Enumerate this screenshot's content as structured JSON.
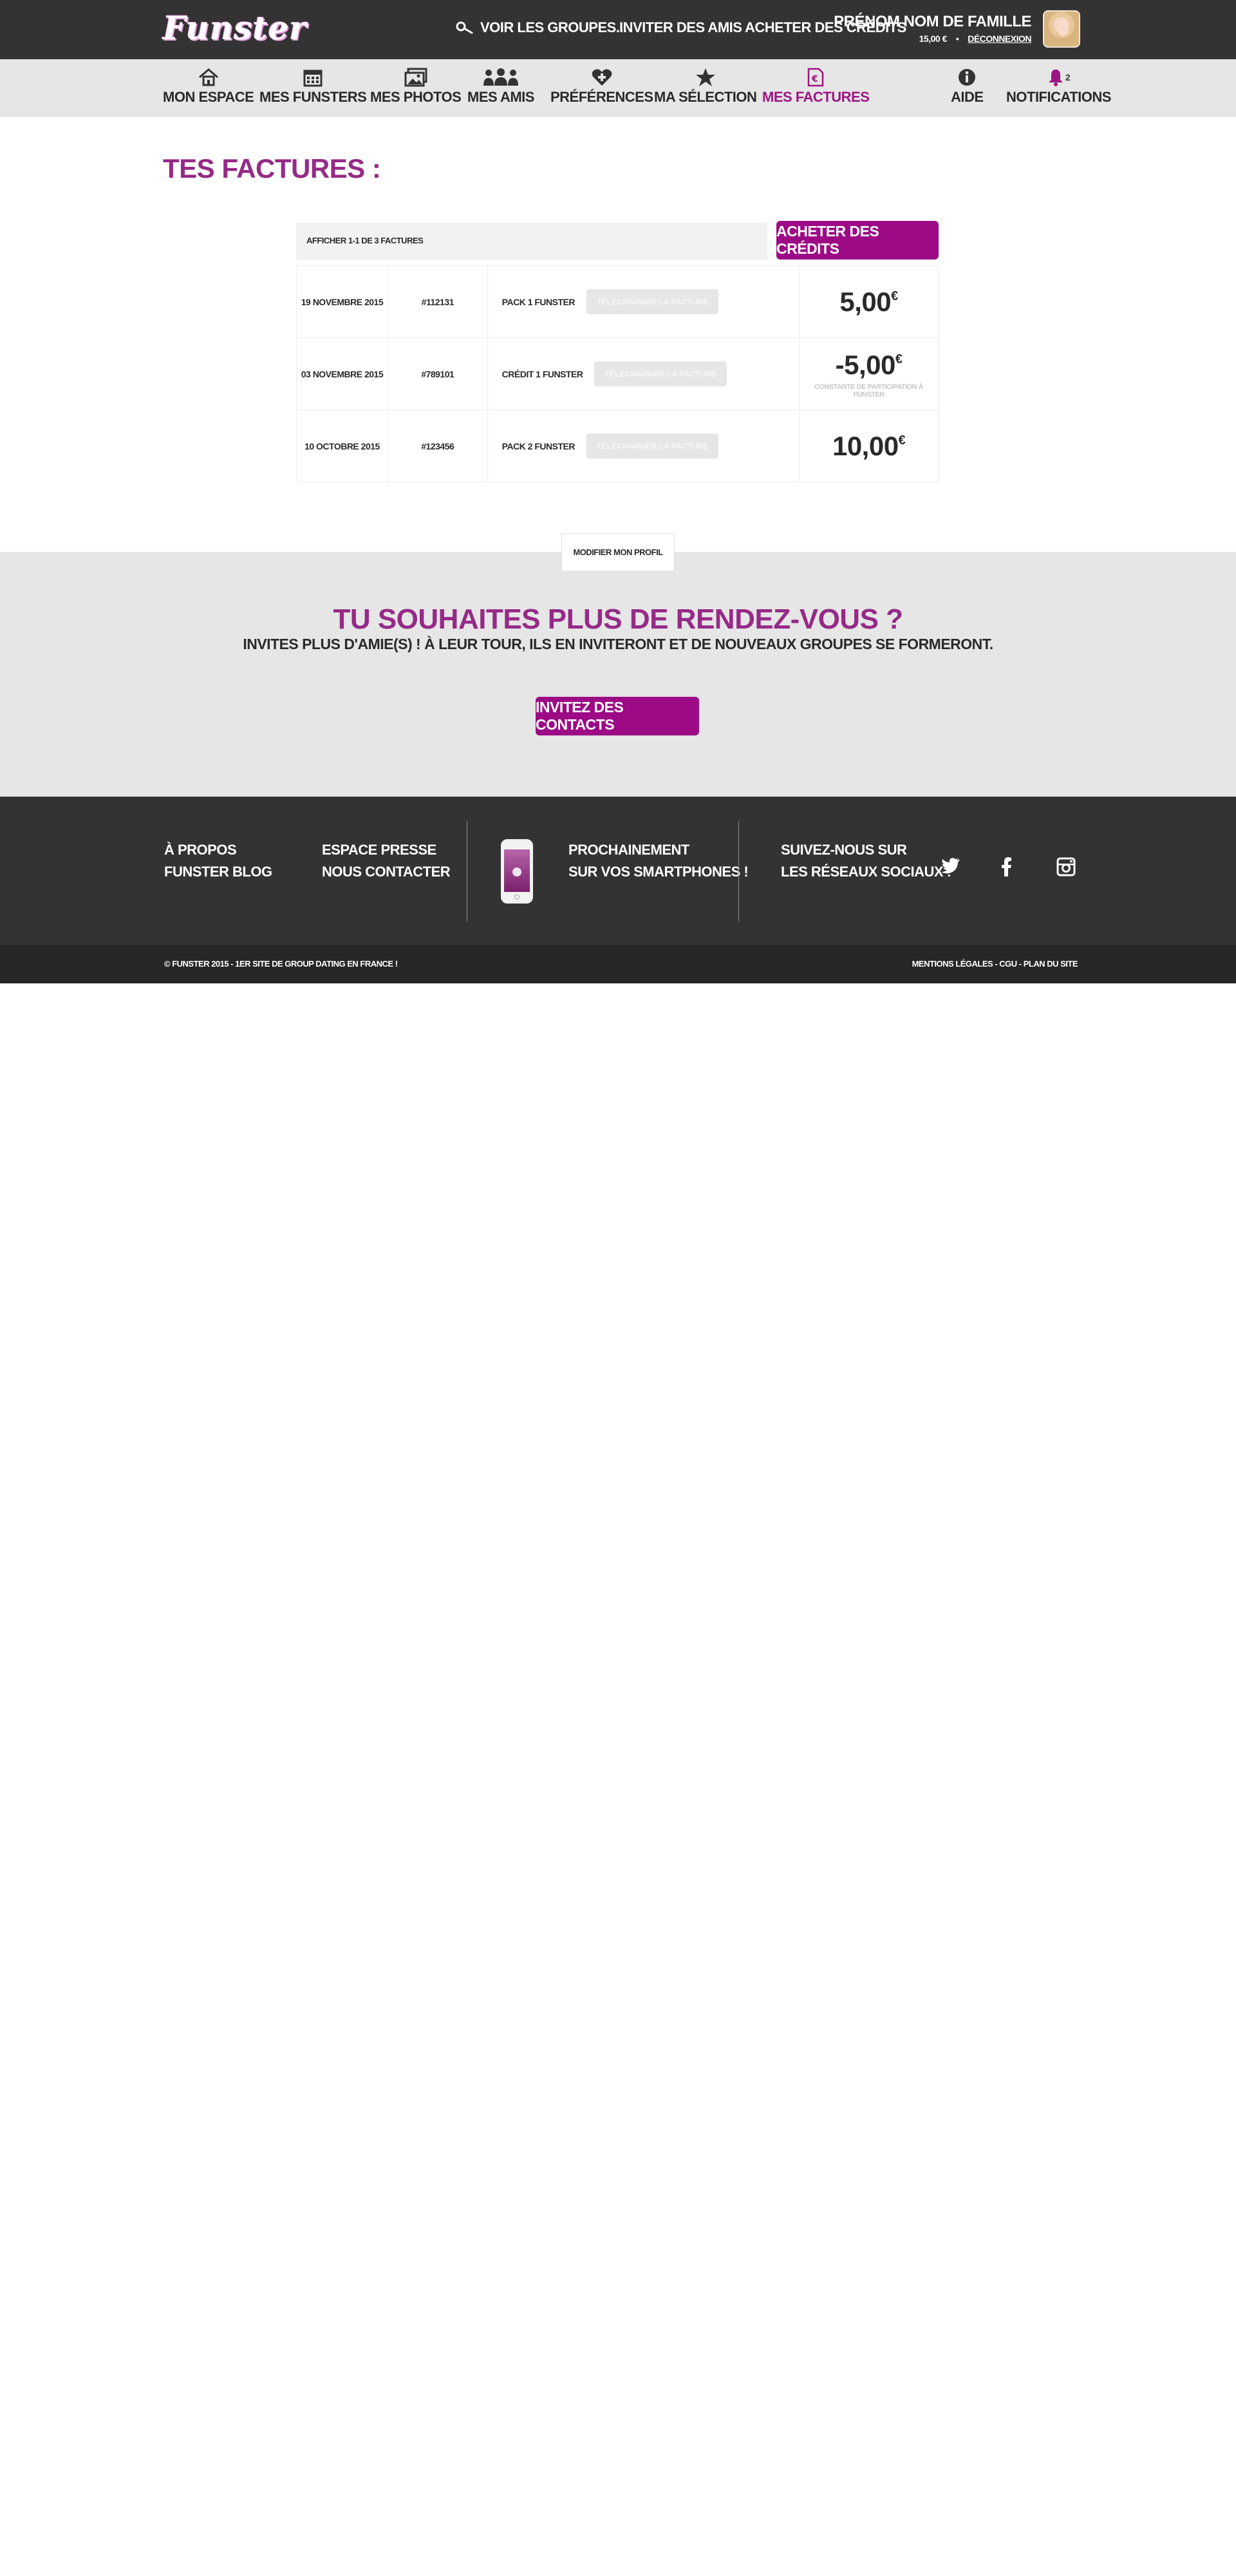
{
  "header": {
    "logo": "Funster",
    "nav": {
      "search": "Voir les groupes...",
      "invite": "Inviter des amis",
      "buy": "Acheter des crédits"
    },
    "user": {
      "name": "Prénom Nom de famille",
      "credits": "15,00 €",
      "separator": "•",
      "logout": "Déconnexion"
    }
  },
  "subnav": {
    "items": [
      {
        "label": "Mon espace",
        "icon": "home-icon"
      },
      {
        "label": "Mes funsters",
        "icon": "calendar-icon"
      },
      {
        "label": "Mes photos",
        "icon": "photos-icon"
      },
      {
        "label": "Mes amis",
        "icon": "friends-icon"
      },
      {
        "label": "Préférences",
        "icon": "heart-plus-icon"
      },
      {
        "label": "Ma sélection",
        "icon": "star-icon"
      },
      {
        "label": "Mes factures",
        "icon": "invoice-icon",
        "active": true
      }
    ],
    "right": [
      {
        "label": "Aide",
        "icon": "info-icon"
      },
      {
        "label": "Notifications",
        "icon": "bell-icon",
        "badge": "2"
      }
    ]
  },
  "main": {
    "title": "Tes factures :",
    "filter": "Afficher 1-1 de 3 factures",
    "buy_button": "Acheter des crédits",
    "invoices": [
      {
        "date": "19 novembre 2015",
        "number": "#112131",
        "description": "Pack 1 Funster",
        "download": "Télécharger la facture",
        "amount": "5,00",
        "currency": "€",
        "note": ""
      },
      {
        "date": "03 novembre 2015",
        "number": "#789101",
        "description": "Crédit 1 Funster",
        "download": "Télécharger la facture",
        "amount": "-5,00",
        "currency": "€",
        "note": "Constante de participation à FUNSTER"
      },
      {
        "date": "10 octobre 2015",
        "number": "#123456",
        "description": "Pack 2 Funster",
        "download": "Télécharger la facture",
        "amount": "10,00",
        "currency": "€",
        "note": ""
      }
    ]
  },
  "profile_tab": "Modifier mon profil",
  "invite": {
    "title": "Tu souhaites plus de rendez-vous ?",
    "subtitle": "Invites plus d'amie(s) ! à leur tour, ils en inviteront et de nouveaux groupes se formeront.",
    "button": "Invitez des contacts"
  },
  "footer": {
    "col1": [
      "À propos",
      "Funster Blog"
    ],
    "col2": [
      "Espace presse",
      "Nous contacter"
    ],
    "app": [
      "Prochainement",
      "sur vos smartphones !"
    ],
    "social_title": [
      "Suivez-nous sur",
      "les réseaux sociaux :"
    ],
    "social": [
      "twitter-icon",
      "facebook-icon",
      "instagram-icon"
    ],
    "copyright": "© Funster 2015 - 1er site de group dating en France !",
    "legal": "Mentions légales - CGU - Plan du site"
  },
  "colors": {
    "brand": "#9c0a86",
    "title": "#952a87",
    "dark": "#333333",
    "light": "#e6e6e6"
  }
}
